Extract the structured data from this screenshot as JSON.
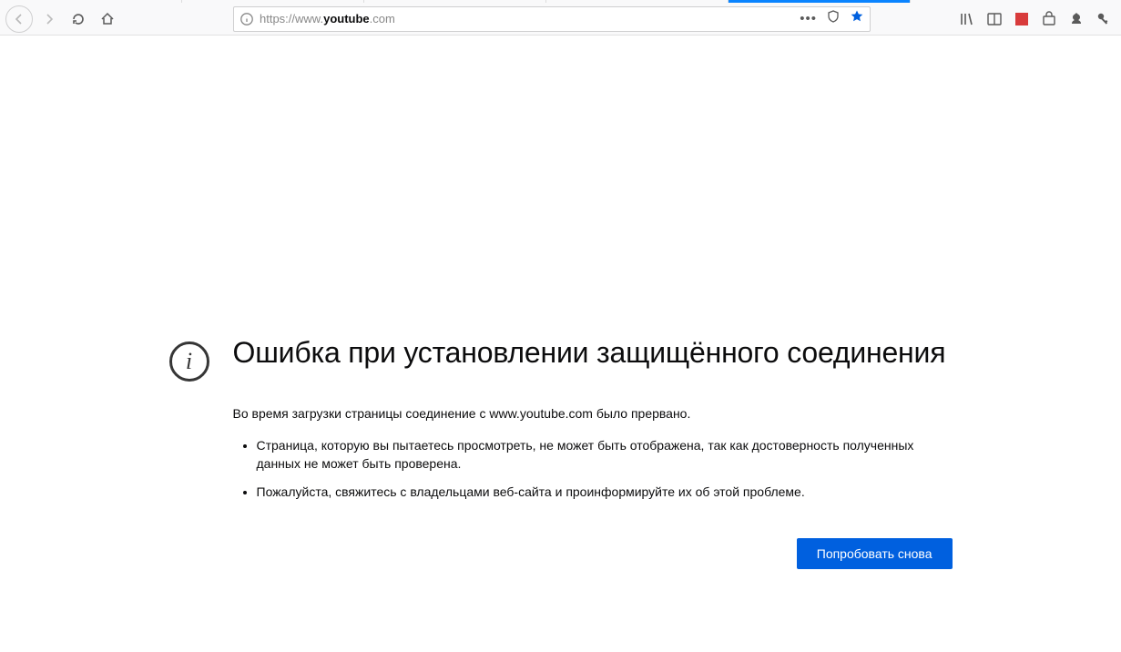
{
  "url_bar": {
    "protocol": "https://",
    "host_prefix": "www.",
    "host_bold": "youtube",
    "host_suffix": ".com",
    "ellipsis": "•••"
  },
  "error": {
    "title": "Ошибка при установлении защищённого соединения",
    "description": "Во время загрузки страницы соединение с www.youtube.com было прервано.",
    "bullets": [
      "Страница, которую вы пытаетесь просмотреть, не может быть отображена, так как достоверность полученных данных не может быть проверена.",
      "Пожалуйста, свяжитесь с владельцами веб-сайта и проинформируйте их об этой проблеме."
    ],
    "retry_label": "Попробовать снова"
  }
}
